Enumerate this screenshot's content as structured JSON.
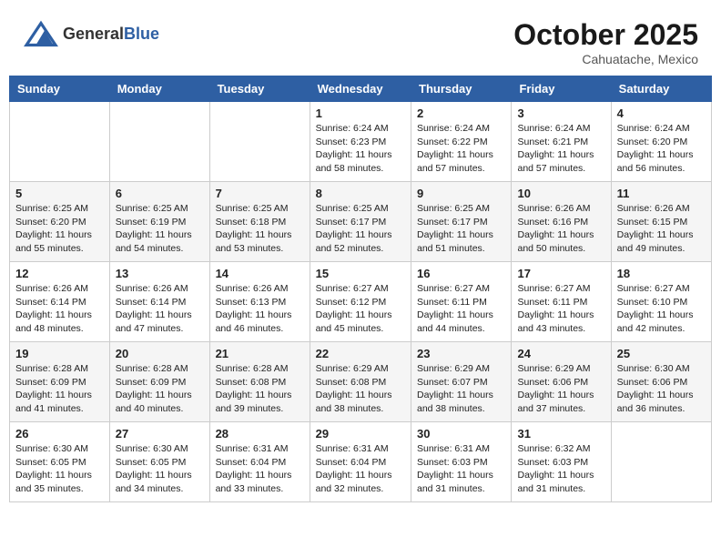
{
  "logo": {
    "general": "General",
    "blue": "Blue"
  },
  "title": "October 2025",
  "location": "Cahuatache, Mexico",
  "weekdays": [
    "Sunday",
    "Monday",
    "Tuesday",
    "Wednesday",
    "Thursday",
    "Friday",
    "Saturday"
  ],
  "weeks": [
    [
      {
        "day": "",
        "info": ""
      },
      {
        "day": "",
        "info": ""
      },
      {
        "day": "",
        "info": ""
      },
      {
        "day": "1",
        "info": "Sunrise: 6:24 AM\nSunset: 6:23 PM\nDaylight: 11 hours\nand 58 minutes."
      },
      {
        "day": "2",
        "info": "Sunrise: 6:24 AM\nSunset: 6:22 PM\nDaylight: 11 hours\nand 57 minutes."
      },
      {
        "day": "3",
        "info": "Sunrise: 6:24 AM\nSunset: 6:21 PM\nDaylight: 11 hours\nand 57 minutes."
      },
      {
        "day": "4",
        "info": "Sunrise: 6:24 AM\nSunset: 6:20 PM\nDaylight: 11 hours\nand 56 minutes."
      }
    ],
    [
      {
        "day": "5",
        "info": "Sunrise: 6:25 AM\nSunset: 6:20 PM\nDaylight: 11 hours\nand 55 minutes."
      },
      {
        "day": "6",
        "info": "Sunrise: 6:25 AM\nSunset: 6:19 PM\nDaylight: 11 hours\nand 54 minutes."
      },
      {
        "day": "7",
        "info": "Sunrise: 6:25 AM\nSunset: 6:18 PM\nDaylight: 11 hours\nand 53 minutes."
      },
      {
        "day": "8",
        "info": "Sunrise: 6:25 AM\nSunset: 6:17 PM\nDaylight: 11 hours\nand 52 minutes."
      },
      {
        "day": "9",
        "info": "Sunrise: 6:25 AM\nSunset: 6:17 PM\nDaylight: 11 hours\nand 51 minutes."
      },
      {
        "day": "10",
        "info": "Sunrise: 6:26 AM\nSunset: 6:16 PM\nDaylight: 11 hours\nand 50 minutes."
      },
      {
        "day": "11",
        "info": "Sunrise: 6:26 AM\nSunset: 6:15 PM\nDaylight: 11 hours\nand 49 minutes."
      }
    ],
    [
      {
        "day": "12",
        "info": "Sunrise: 6:26 AM\nSunset: 6:14 PM\nDaylight: 11 hours\nand 48 minutes."
      },
      {
        "day": "13",
        "info": "Sunrise: 6:26 AM\nSunset: 6:14 PM\nDaylight: 11 hours\nand 47 minutes."
      },
      {
        "day": "14",
        "info": "Sunrise: 6:26 AM\nSunset: 6:13 PM\nDaylight: 11 hours\nand 46 minutes."
      },
      {
        "day": "15",
        "info": "Sunrise: 6:27 AM\nSunset: 6:12 PM\nDaylight: 11 hours\nand 45 minutes."
      },
      {
        "day": "16",
        "info": "Sunrise: 6:27 AM\nSunset: 6:11 PM\nDaylight: 11 hours\nand 44 minutes."
      },
      {
        "day": "17",
        "info": "Sunrise: 6:27 AM\nSunset: 6:11 PM\nDaylight: 11 hours\nand 43 minutes."
      },
      {
        "day": "18",
        "info": "Sunrise: 6:27 AM\nSunset: 6:10 PM\nDaylight: 11 hours\nand 42 minutes."
      }
    ],
    [
      {
        "day": "19",
        "info": "Sunrise: 6:28 AM\nSunset: 6:09 PM\nDaylight: 11 hours\nand 41 minutes."
      },
      {
        "day": "20",
        "info": "Sunrise: 6:28 AM\nSunset: 6:09 PM\nDaylight: 11 hours\nand 40 minutes."
      },
      {
        "day": "21",
        "info": "Sunrise: 6:28 AM\nSunset: 6:08 PM\nDaylight: 11 hours\nand 39 minutes."
      },
      {
        "day": "22",
        "info": "Sunrise: 6:29 AM\nSunset: 6:08 PM\nDaylight: 11 hours\nand 38 minutes."
      },
      {
        "day": "23",
        "info": "Sunrise: 6:29 AM\nSunset: 6:07 PM\nDaylight: 11 hours\nand 38 minutes."
      },
      {
        "day": "24",
        "info": "Sunrise: 6:29 AM\nSunset: 6:06 PM\nDaylight: 11 hours\nand 37 minutes."
      },
      {
        "day": "25",
        "info": "Sunrise: 6:30 AM\nSunset: 6:06 PM\nDaylight: 11 hours\nand 36 minutes."
      }
    ],
    [
      {
        "day": "26",
        "info": "Sunrise: 6:30 AM\nSunset: 6:05 PM\nDaylight: 11 hours\nand 35 minutes."
      },
      {
        "day": "27",
        "info": "Sunrise: 6:30 AM\nSunset: 6:05 PM\nDaylight: 11 hours\nand 34 minutes."
      },
      {
        "day": "28",
        "info": "Sunrise: 6:31 AM\nSunset: 6:04 PM\nDaylight: 11 hours\nand 33 minutes."
      },
      {
        "day": "29",
        "info": "Sunrise: 6:31 AM\nSunset: 6:04 PM\nDaylight: 11 hours\nand 32 minutes."
      },
      {
        "day": "30",
        "info": "Sunrise: 6:31 AM\nSunset: 6:03 PM\nDaylight: 11 hours\nand 31 minutes."
      },
      {
        "day": "31",
        "info": "Sunrise: 6:32 AM\nSunset: 6:03 PM\nDaylight: 11 hours\nand 31 minutes."
      },
      {
        "day": "",
        "info": ""
      }
    ]
  ]
}
